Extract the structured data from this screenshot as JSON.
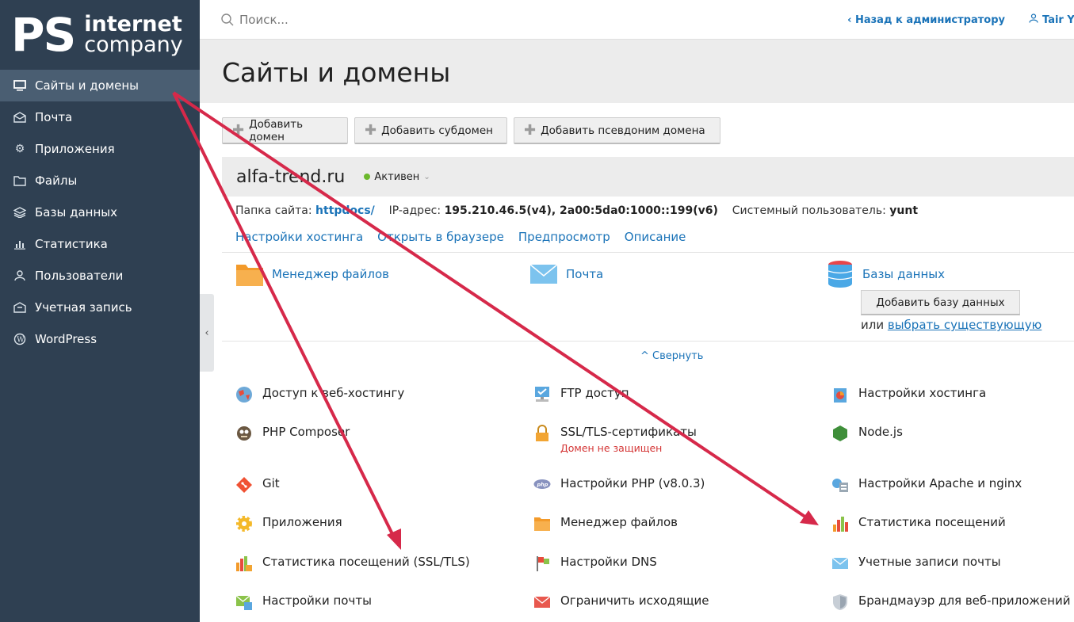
{
  "brand": {
    "ps": "PS",
    "line1": "internet",
    "line2": "company"
  },
  "sidebar": {
    "items": [
      {
        "label": "Сайты и домены"
      },
      {
        "label": "Почта"
      },
      {
        "label": "Приложения"
      },
      {
        "label": "Файлы"
      },
      {
        "label": "Базы данных"
      },
      {
        "label": "Статистика"
      },
      {
        "label": "Пользователи"
      },
      {
        "label": "Учетная запись"
      },
      {
        "label": "WordPress"
      }
    ],
    "collapse_glyph": "‹"
  },
  "topbar": {
    "search_placeholder": "Поиск...",
    "back_link": "‹ Назад к администратору",
    "user": "Tair Y"
  },
  "page": {
    "title": "Сайты и домены"
  },
  "actions": {
    "add_domain": "Добавить домен",
    "add_subdomain": "Добавить субдомен",
    "add_alias": "Добавить псевдоним домена"
  },
  "domain": {
    "name": "alfa-trend.ru",
    "status": "Активен",
    "folder_label": "Папка сайта:",
    "folder_value": "httpdocs/",
    "ip_label": "IP-адрес:",
    "ip_value": "195.210.46.5(v4), 2a00:5da0:1000::199(v6)",
    "sysuser_label": "Системный пользователь:",
    "sysuser_value": "yunt",
    "links": [
      "Настройки хостинга",
      "Открыть в браузере",
      "Предпросмотр",
      "Описание"
    ]
  },
  "main_tools": {
    "file_manager": "Менеджер файлов",
    "mail": "Почта",
    "databases": "Базы данных",
    "add_db_button": "Добавить базу данных",
    "or_text": "или",
    "pick_existing": "выбрать существующую"
  },
  "collapse_label": "^ Свернуть",
  "tools": [
    {
      "label": "Доступ к веб-хостингу",
      "icon": "globe-icon"
    },
    {
      "label": "FTP доступ",
      "icon": "ftp-icon"
    },
    {
      "label": "Настройки хостинга",
      "icon": "hosting-settings-icon"
    },
    {
      "label": "PHP Composer",
      "icon": "composer-icon"
    },
    {
      "label": "SSL/TLS-сертификаты",
      "icon": "ssl-lock-icon",
      "sub": "Домен не защищен"
    },
    {
      "label": "Node.js",
      "icon": "nodejs-icon"
    },
    {
      "label": "Git",
      "icon": "git-icon"
    },
    {
      "label": "Настройки PHP (v8.0.3)",
      "icon": "php-icon"
    },
    {
      "label": "Настройки Apache и nginx",
      "icon": "apache-icon"
    },
    {
      "label": "Приложения",
      "icon": "apps-gear-icon"
    },
    {
      "label": "Менеджер файлов",
      "icon": "folder-icon"
    },
    {
      "label": "Статистика посещений",
      "icon": "bar-stats-icon"
    },
    {
      "label": "Статистика посещений (SSL/TLS)",
      "icon": "ssl-stats-icon"
    },
    {
      "label": "Настройки DNS",
      "icon": "dns-flags-icon"
    },
    {
      "label": "Учетные записи почты",
      "icon": "envelope-icon"
    },
    {
      "label": "Настройки почты",
      "icon": "mail-settings-icon"
    },
    {
      "label": "Ограничить исходящие",
      "icon": "mail-limit-icon"
    },
    {
      "label": "Брандмауэр для веб-приложений",
      "icon": "shield-icon"
    }
  ],
  "colors": {
    "sidebar": "#2f4052",
    "link": "#1a73b8",
    "annotation_arrow": "#d6294a",
    "active_status": "#6bb82c"
  }
}
